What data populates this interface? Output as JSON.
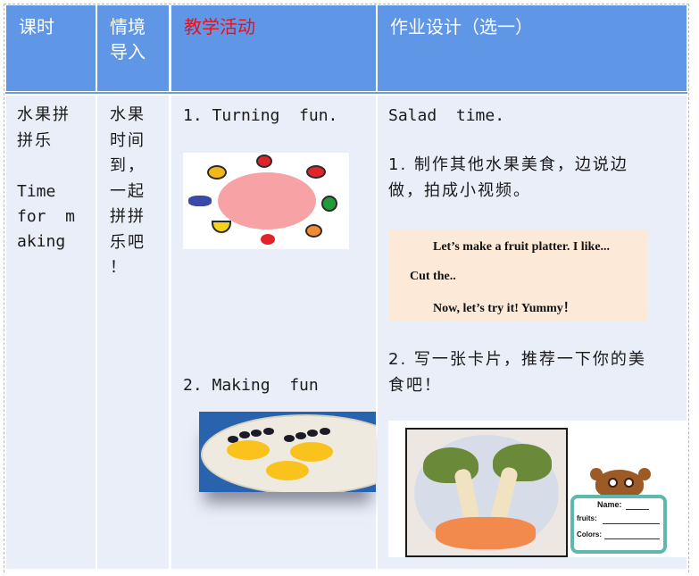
{
  "table": {
    "headers": {
      "lesson": "课时",
      "scenario": "情境导入",
      "scenario_lines": [
        "情境",
        "导入"
      ],
      "activities": "教学活动",
      "homework": "作业设计（选一）"
    },
    "colors": {
      "header_bg": "#5f96e6",
      "header_text": "#ffffff",
      "activities_header_text": "#e8101b",
      "body_bg": "#e9eef9"
    },
    "row": {
      "lesson": {
        "title_lines": [
          "水果拼",
          "拼乐"
        ],
        "english_lines": [
          "Time",
          "for  m",
          "aking"
        ]
      },
      "scenario": {
        "lines": [
          "水果",
          "时间",
          "到，",
          "一起",
          "拼拼",
          "乐吧",
          "！"
        ]
      },
      "activities": {
        "item1": "1. Turning  fun.",
        "item1_image": "fruit-wheel-image",
        "item2": "2. Making  fun",
        "item2_image": "orange-chick-plate-photo"
      },
      "homework": {
        "intro": "Salad  time.",
        "task1_lines": [
          "1. 制作其他水果美食，边说边",
          "做，拍成小视频。"
        ],
        "platter_card": {
          "line1": "Let’s make a fruit platter. I like...",
          "line2": "Cut the..",
          "line3": "Now, let’s try it! Yummy！"
        },
        "task2_lines": [
          "2. 写一张卡片，推荐一下你的美",
          "食吧！"
        ],
        "palm_tree_image": "kiwi-banana-palm-tree-photo",
        "bear_card": {
          "name_label": "Name:",
          "fruits_label": "fruits:",
          "colors_label": "Colors:"
        }
      }
    }
  }
}
